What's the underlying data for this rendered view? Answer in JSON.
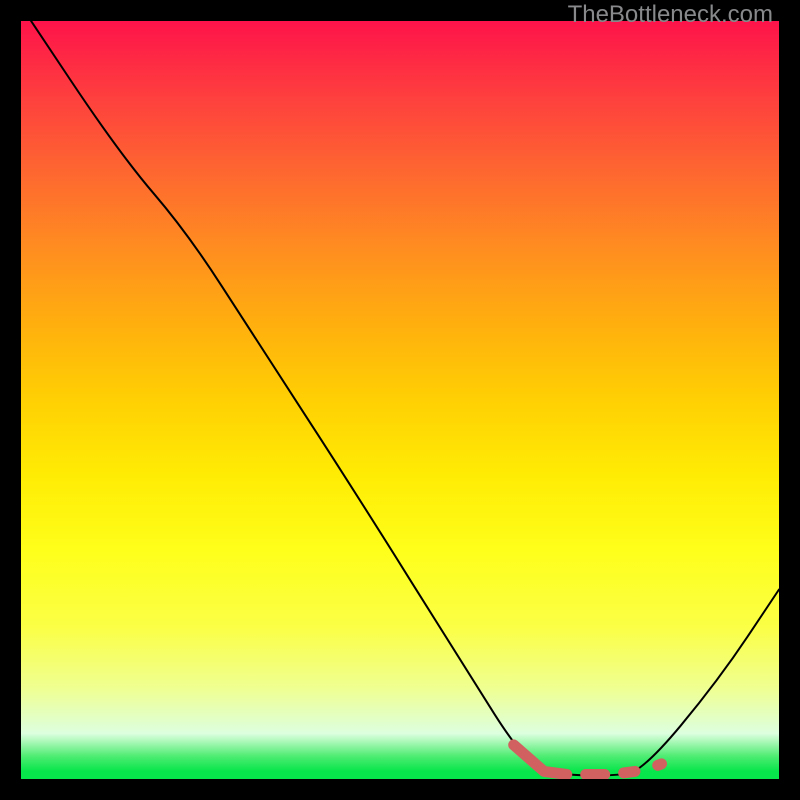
{
  "watermark": "TheBottleneck.com",
  "chart_data": {
    "type": "line",
    "title": "",
    "xlabel": "",
    "ylabel": "",
    "xlim": [
      0,
      1
    ],
    "ylim": [
      0,
      1
    ],
    "series": [
      {
        "name": "bottleneck-curve",
        "color": "#000000",
        "stroke_width": 2,
        "points": [
          {
            "x": 0.0,
            "y": 1.02
          },
          {
            "x": 0.13,
            "y": 0.825
          },
          {
            "x": 0.22,
            "y": 0.72
          },
          {
            "x": 0.31,
            "y": 0.58
          },
          {
            "x": 0.44,
            "y": 0.38
          },
          {
            "x": 0.59,
            "y": 0.14
          },
          {
            "x": 0.66,
            "y": 0.03
          },
          {
            "x": 0.7,
            "y": 0.006
          },
          {
            "x": 0.78,
            "y": 0.004
          },
          {
            "x": 0.82,
            "y": 0.01
          },
          {
            "x": 0.92,
            "y": 0.13
          },
          {
            "x": 1.0,
            "y": 0.25
          }
        ]
      },
      {
        "name": "highlight-band",
        "color": "#d16060",
        "stroke_width": 11,
        "points": [
          {
            "x": 0.65,
            "y": 0.045
          },
          {
            "x": 0.69,
            "y": 0.01
          },
          {
            "x": 0.72,
            "y": 0.006
          }
        ]
      },
      {
        "name": "highlight-dash-1",
        "color": "#d16060",
        "stroke_width": 11,
        "points": [
          {
            "x": 0.745,
            "y": 0.006
          },
          {
            "x": 0.77,
            "y": 0.006
          }
        ]
      },
      {
        "name": "highlight-dash-2",
        "color": "#d16060",
        "stroke_width": 11,
        "points": [
          {
            "x": 0.795,
            "y": 0.008
          },
          {
            "x": 0.81,
            "y": 0.01
          }
        ]
      },
      {
        "name": "highlight-dot",
        "color": "#d16060",
        "stroke_width": 11,
        "points": [
          {
            "x": 0.84,
            "y": 0.018
          },
          {
            "x": 0.845,
            "y": 0.02
          }
        ]
      }
    ],
    "background_gradient": {
      "orientation": "vertical",
      "stops": [
        {
          "pos": 0.0,
          "color": "#fe134a"
        },
        {
          "pos": 0.5,
          "color": "#ffd003"
        },
        {
          "pos": 0.8,
          "color": "#fbff46"
        },
        {
          "pos": 0.97,
          "color": "#4eec72"
        },
        {
          "pos": 1.0,
          "color": "#07e64a"
        }
      ]
    }
  }
}
